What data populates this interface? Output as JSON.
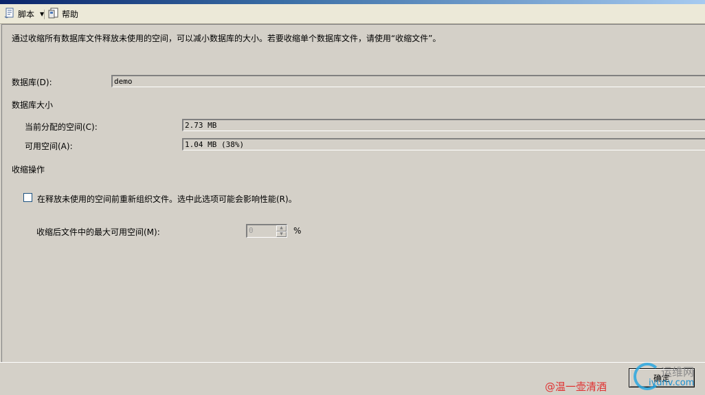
{
  "toolbar": {
    "script_label": "脚本",
    "help_label": "帮助"
  },
  "description": "通过收缩所有数据库文件释放未使用的空间，可以减小数据库的大小。若要收缩单个数据库文件，请使用“收缩文件”。",
  "database": {
    "label": "数据库(D):",
    "value": "demo"
  },
  "db_size": {
    "section_title": "数据库大小",
    "allocated_label": "当前分配的空间(C):",
    "allocated_value": "2.73 MB",
    "free_label": "可用空间(A):",
    "free_value": "1.04 MB (38%)"
  },
  "shrink": {
    "section_title": "收缩操作",
    "reorganize_label": "在释放未使用的空间前重新组织文件。选中此选项可能会影响性能(R)。",
    "reorganize_checked": false,
    "max_free_label": "收缩后文件中的最大可用空间(M):",
    "max_free_value": "0",
    "max_free_unit": "%"
  },
  "footer": {
    "ok_label": "确定",
    "watermark": "@温一壶清酒",
    "logo_line1": "运维网",
    "logo_line2": "iyunv.com"
  },
  "colors": {
    "background": "#d4d0c8",
    "toolbar": "#ece9d8",
    "watermark": "#e03030"
  }
}
